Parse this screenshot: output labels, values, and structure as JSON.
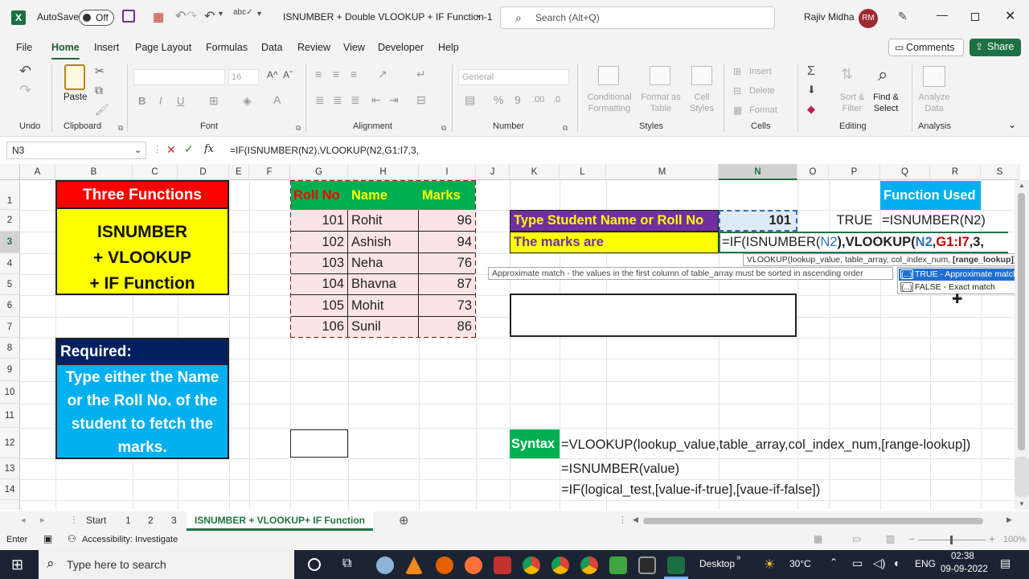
{
  "title_bar": {
    "autosave_label": "AutoSave",
    "autosave_state": "Off",
    "document_title": "ISNUMBER + Double VLOOKUP + IF Function-1",
    "search_placeholder": "Search (Alt+Q)",
    "user_name": "Rajiv Midha",
    "user_initials": "RM"
  },
  "menu": {
    "items": [
      "File",
      "Home",
      "Insert",
      "Page Layout",
      "Formulas",
      "Data",
      "Review",
      "View",
      "Developer",
      "Help"
    ],
    "active": "Home",
    "comments": "Comments",
    "share": "Share"
  },
  "ribbon": {
    "groups": [
      "Undo",
      "Clipboard",
      "Font",
      "Alignment",
      "Number",
      "Styles",
      "Cells",
      "Editing",
      "Analysis"
    ],
    "paste": "Paste",
    "font_size": "16",
    "number_format": "General",
    "styles": [
      "Conditional Formatting",
      "Format as Table",
      "Cell Styles"
    ],
    "cells": [
      "Insert",
      "Delete",
      "Format"
    ],
    "find_select": "Find & Select",
    "sort_filter": "Sort & Filter",
    "analyze_data": "Analyze Data"
  },
  "formula_bar": {
    "name_box": "N3",
    "fx": "fx",
    "formula": "=IF(ISNUMBER(N2),VLOOKUP(N2,G1:I7,3,"
  },
  "columns": [
    "A",
    "B",
    "C",
    "D",
    "E",
    "F",
    "G",
    "H",
    "I",
    "J",
    "K",
    "L",
    "M",
    "N",
    "O",
    "P",
    "Q",
    "R",
    "S"
  ],
  "rows": [
    "1",
    "2",
    "3",
    "4",
    "5",
    "6",
    "7",
    "8",
    "9",
    "10",
    "11",
    "12",
    "13",
    "14"
  ],
  "sheet": {
    "three_functions_title": "Three Functions",
    "functions_box": [
      "ISNUMBER",
      "+ VLOOKUP",
      "+ IF Function"
    ],
    "required_title": "Required:",
    "required_text": [
      "Type either the Name",
      "or the Roll No. of the",
      "student to fetch the",
      "marks."
    ],
    "table_headers": [
      "Roll No",
      "Name",
      "Marks"
    ],
    "table_rows": [
      [
        "101",
        "Rohit",
        "96"
      ],
      [
        "102",
        "Ashish",
        "94"
      ],
      [
        "103",
        "Neha",
        "76"
      ],
      [
        "104",
        "Bhavna",
        "87"
      ],
      [
        "105",
        "Mohit",
        "73"
      ],
      [
        "106",
        "Sunil",
        "86"
      ]
    ],
    "type_label": "Type Student Name or Roll No",
    "input_value": "101",
    "marks_label": "The marks are",
    "formula_parts": [
      "=IF(ISNUMBER(",
      "N2",
      "),",
      "VLOOKUP(",
      "N2",
      ",",
      "G1:I7",
      ",3,"
    ],
    "p2_value": "TRUE",
    "function_used_title": "Function Used",
    "function_used_value": "=ISNUMBER(N2)",
    "syntax_label": "Syntax",
    "syntax_lines": [
      "=VLOOKUP(lookup_value,table_array,col_index_num,[range-lookup])",
      "=ISNUMBER(value)",
      "=IF(logical_test,[value-if-true],[vaue-if-false])"
    ]
  },
  "tooltip": {
    "signature_prefix": "VLOOKUP(lookup_value, table_array, col_index_num, ",
    "signature_bold": "[range_lookup]",
    "signature_suffix": ")",
    "hint": "Approximate match - the values in the first column of table_array must be sorted in ascending order",
    "options": [
      "TRUE - Approximate match",
      "FALSE - Exact match"
    ],
    "option_icon": "(...)"
  },
  "sheet_tabs": {
    "tabs": [
      "Start",
      "1",
      "2",
      "3",
      "ISNUMBER + VLOOKUP+ IF Function"
    ],
    "active": "ISNUMBER + VLOOKUP+ IF Function"
  },
  "status_bar": {
    "mode": "Enter",
    "accessibility": "Accessibility: Investigate",
    "zoom": "100%"
  },
  "taskbar": {
    "search_placeholder": "Type here to search",
    "desktop": "Desktop",
    "temperature": "30°C",
    "language": "ENG",
    "time": "02:38",
    "date": "09-09-2022"
  },
  "colors": {
    "excel_green": "#217346",
    "red_header": "#ff0000",
    "yellow": "#ffff00",
    "navy": "#002060",
    "sky": "#00b0f0",
    "table_header_green": "#00b050",
    "table_row_pink": "#fbe4e4",
    "purple": "#7030a0",
    "syntax_green": "#00b050"
  }
}
